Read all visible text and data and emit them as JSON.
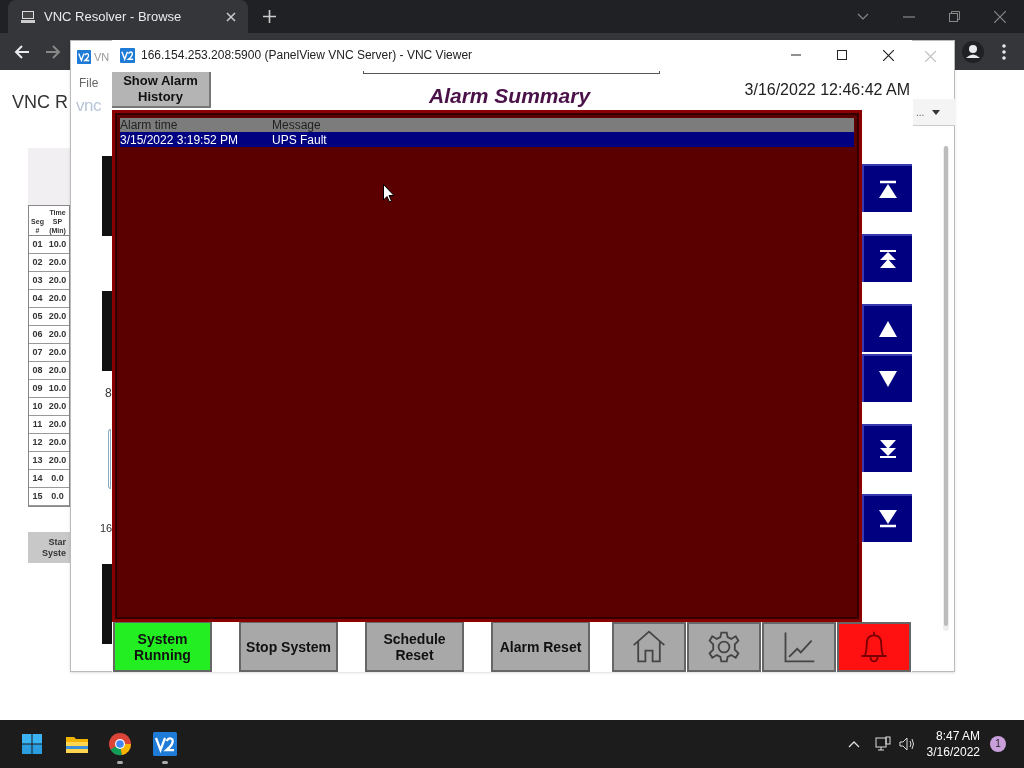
{
  "browser": {
    "tab_title": "VNC Resolver - Browse",
    "page_heading": "VNC R",
    "segment_table": {
      "columns": [
        "Seg #",
        "Time SP (Min)"
      ],
      "rows": [
        [
          "01",
          "10.0"
        ],
        [
          "02",
          "20.0"
        ],
        [
          "03",
          "20.0"
        ],
        [
          "04",
          "20.0"
        ],
        [
          "05",
          "20.0"
        ],
        [
          "06",
          "20.0"
        ],
        [
          "07",
          "20.0"
        ],
        [
          "08",
          "20.0"
        ],
        [
          "09",
          "10.0"
        ],
        [
          "10",
          "20.0"
        ],
        [
          "11",
          "20.0"
        ],
        [
          "12",
          "20.0"
        ],
        [
          "13",
          "20.0"
        ],
        [
          "14",
          "0.0"
        ],
        [
          "15",
          "0.0"
        ]
      ]
    },
    "start_button": [
      "Star",
      "Syste"
    ]
  },
  "back_window": {
    "title": "VN",
    "menu": [
      "File"
    ],
    "logo_text": "vnc",
    "texts": [
      "8",
      "16"
    ],
    "dropdown": "..."
  },
  "vnc_window": {
    "title": "166.154.253.208:5900 (PanelView VNC Server) - VNC Viewer",
    "history_button": "Show Alarm History",
    "heading": "Alarm Summary",
    "datetime": "3/16/2022 12:46:42 AM",
    "alarm_table": {
      "columns": [
        "Alarm time",
        "Message"
      ],
      "rows": [
        {
          "time": "3/15/2022 3:19:52 PM",
          "message": "UPS Fault",
          "selected": true
        }
      ]
    },
    "nav_buttons": [
      {
        "kind": "top"
      },
      {
        "kind": "page_up"
      },
      {
        "kind": "up"
      },
      {
        "kind": "down"
      },
      {
        "kind": "page_down"
      },
      {
        "kind": "bottom"
      }
    ],
    "bottom_buttons": [
      {
        "kind": "text",
        "label": "System Running",
        "color": "#22ee22"
      },
      {
        "kind": "text",
        "label": "Stop System",
        "color": "#a8a8a8"
      },
      {
        "kind": "text",
        "label": "Schedule Reset",
        "color": "#a8a8a8"
      },
      {
        "kind": "text",
        "label": "Alarm Reset",
        "color": "#a8a8a8"
      },
      {
        "kind": "home",
        "color": "#a8a8a8"
      },
      {
        "kind": "settings",
        "color": "#a8a8a8"
      },
      {
        "kind": "trend",
        "color": "#a8a8a8"
      },
      {
        "kind": "alarm",
        "color": "#ff1111"
      }
    ]
  },
  "taskbar": {
    "apps": [
      {
        "kind": "start",
        "running": false
      },
      {
        "kind": "explorer",
        "running": false
      },
      {
        "kind": "chrome",
        "running": true
      },
      {
        "kind": "vnc",
        "running": true
      }
    ],
    "time": "8:47 AM",
    "date": "3/16/2022",
    "notifications": "1"
  }
}
